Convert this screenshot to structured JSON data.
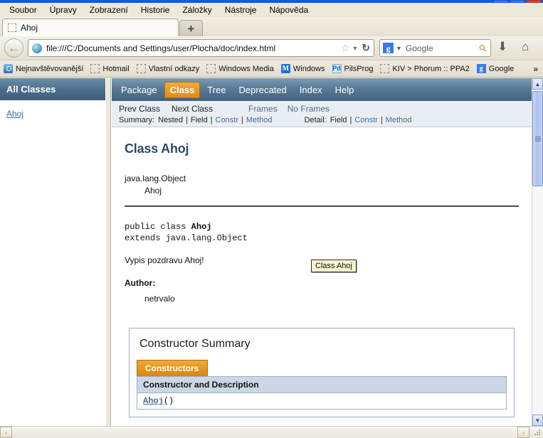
{
  "window": {
    "controls": [
      "minimize",
      "maximize",
      "close"
    ]
  },
  "menubar": {
    "items": [
      {
        "label": "Soubor",
        "accel": "S"
      },
      {
        "label": "Úpravy",
        "accel": "a"
      },
      {
        "label": "Zobrazení",
        "accel": "Z"
      },
      {
        "label": "Historie",
        "accel": "H"
      },
      {
        "label": "Záložky",
        "accel": "o"
      },
      {
        "label": "Nástroje",
        "accel": "N"
      },
      {
        "label": "Nápověda",
        "accel": "v"
      }
    ]
  },
  "tabs": {
    "items": [
      {
        "label": "Ahoj",
        "favicon": "blank-page-icon"
      }
    ],
    "new_tab_label": "+"
  },
  "toolbar": {
    "back_icon": "back-arrow-icon",
    "url": "file:///C:/Documents and Settings/user/Plocha/doc/index.html",
    "site_icon": "globe-icon",
    "bookmark_icon": "star-icon",
    "dropdown_icon": "chevron-down-icon",
    "reload_icon": "reload-icon",
    "search_engine": "Google",
    "search_engine_icon": "google-g-icon",
    "search_placeholder": "Google",
    "search_icon": "magnifier-icon",
    "downloads_icon": "download-arrow-icon",
    "home_icon": "home-icon"
  },
  "bookmarks": {
    "items": [
      {
        "label": "Nejnavštěvovanější",
        "icon": "most-visited-folder-icon"
      },
      {
        "label": "Hotmail",
        "icon": "blank-page-icon"
      },
      {
        "label": "Vlastní odkazy",
        "icon": "blank-page-icon"
      },
      {
        "label": "Windows Media",
        "icon": "blank-page-icon"
      },
      {
        "label": "Windows",
        "icon": "msn-icon"
      },
      {
        "label": "PilsProg",
        "icon": "pilsprog-icon"
      },
      {
        "label": "KIV > Phorum :: PPA2",
        "icon": "blank-page-icon"
      },
      {
        "label": "Google",
        "icon": "google-g-icon"
      }
    ],
    "overflow_label": "»"
  },
  "page": {
    "left_frame": {
      "header": "All Classes",
      "links": [
        "Ahoj"
      ]
    },
    "topnav": {
      "items": [
        {
          "label": "Package",
          "active": false
        },
        {
          "label": "Class",
          "active": true
        },
        {
          "label": "Tree",
          "active": false
        },
        {
          "label": "Deprecated",
          "active": false
        },
        {
          "label": "Index",
          "active": false
        },
        {
          "label": "Help",
          "active": false
        }
      ]
    },
    "subnav": {
      "prev_class": "Prev Class",
      "next_class": "Next Class",
      "frames": "Frames",
      "no_frames": "No Frames",
      "summary_label": "Summary:",
      "summary_items": [
        "Nested",
        "Field",
        "Constr",
        "Method"
      ],
      "detail_label": "Detail:",
      "detail_items": [
        "Field",
        "Constr",
        "Method"
      ],
      "separator": "|"
    },
    "main": {
      "title": "Class Ahoj",
      "inheritance": [
        "java.lang.Object",
        "Ahoj"
      ],
      "declaration_line1_prefix": "public class ",
      "declaration_line1_name": "Ahoj",
      "declaration_line2": "extends java.lang.Object",
      "description": "Vypis pozdravu Ahoj!",
      "author_label": "Author:",
      "author_value": "netrvalo",
      "constructor_summary": {
        "heading": "Constructor Summary",
        "tab_label": "Constructors",
        "column_header": "Constructor and Description",
        "rows": [
          {
            "name": "Ahoj",
            "signature": "()"
          }
        ]
      }
    },
    "tooltip": "Class Ahoj"
  },
  "scrollbars": {
    "vertical": {
      "up": "▲",
      "down": "▼"
    },
    "horizontal": {
      "left": "‹",
      "right": "›"
    }
  },
  "colors": {
    "javadoc_nav_blue": "#587a98",
    "javadoc_active_orange": "#dd8d14",
    "javadoc_link": "#4a6b8a",
    "javadoc_heading": "#2c4a66",
    "table_header": "#ccd7e6",
    "chrome_bg": "#ece9d8",
    "titlebar_blue": "#0a56d6"
  }
}
